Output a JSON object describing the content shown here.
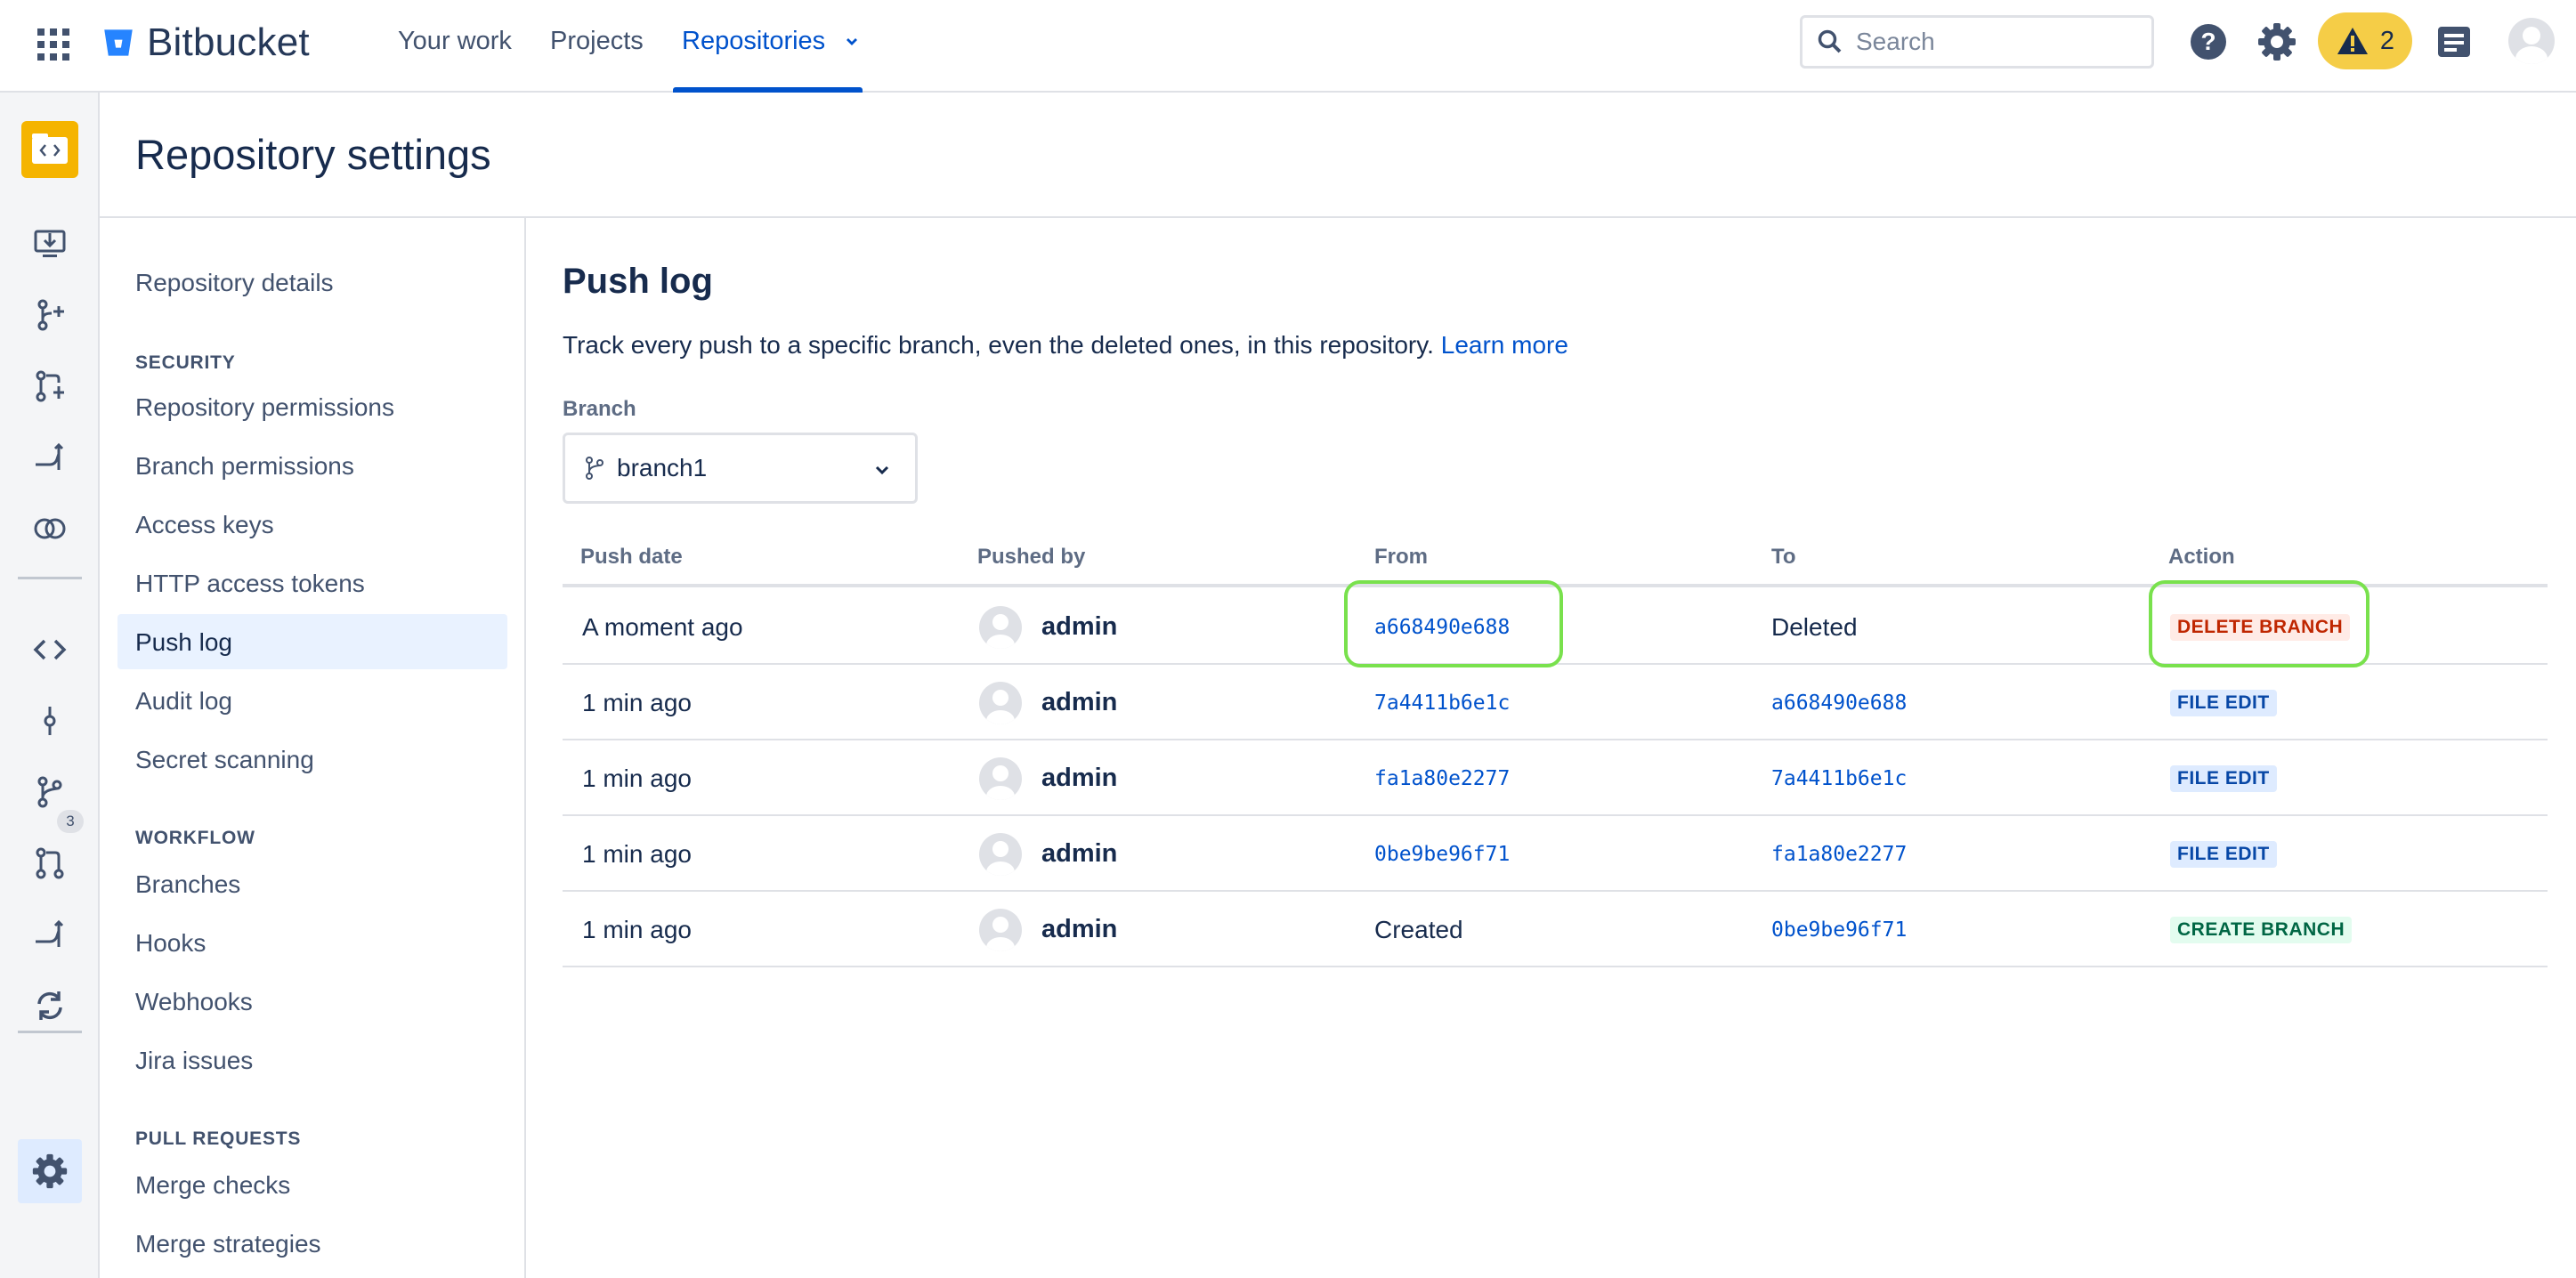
{
  "topbar": {
    "logo_text": "Bitbucket",
    "nav": [
      "Your work",
      "Projects",
      "Repositories"
    ],
    "search_placeholder": "Search",
    "warning_count": "2"
  },
  "rail": {
    "pr_badge": "3"
  },
  "page": {
    "title": "Repository settings"
  },
  "sidebar": {
    "top_link": "Repository details",
    "sections": [
      {
        "title": "SECURITY",
        "items": [
          "Repository permissions",
          "Branch permissions",
          "Access keys",
          "HTTP access tokens",
          "Push log",
          "Audit log",
          "Secret scanning"
        ]
      },
      {
        "title": "WORKFLOW",
        "items": [
          "Branches",
          "Hooks",
          "Webhooks",
          "Jira issues"
        ]
      },
      {
        "title": "PULL REQUESTS",
        "items": [
          "Merge checks",
          "Merge strategies"
        ]
      }
    ],
    "active_item": "Push log"
  },
  "content": {
    "title": "Push log",
    "description": "Track every push to a specific branch, even the deleted ones, in this repository.",
    "learn_more": "Learn more",
    "branch_label": "Branch",
    "branch_value": "branch1"
  },
  "table": {
    "headers": [
      "Push date",
      "Pushed by",
      "From",
      "To",
      "Action"
    ],
    "rows": [
      {
        "date": "A moment ago",
        "user": "admin",
        "from": "a668490e688",
        "to": "Deleted",
        "action": "DELETE BRANCH"
      },
      {
        "date": "1 min ago",
        "user": "admin",
        "from": "7a4411b6e1c",
        "to": "a668490e688",
        "action": "FILE EDIT"
      },
      {
        "date": "1 min ago",
        "user": "admin",
        "from": "fa1a80e2277",
        "to": "7a4411b6e1c",
        "action": "FILE EDIT"
      },
      {
        "date": "1 min ago",
        "user": "admin",
        "from": "0be9be96f71",
        "to": "fa1a80e2277",
        "action": "FILE EDIT"
      },
      {
        "date": "1 min ago",
        "user": "admin",
        "from": "Created",
        "to": "0be9be96f71",
        "action": "CREATE BRANCH"
      }
    ]
  },
  "colors": {
    "brand": "#0052cc",
    "highlight": "#79e14d",
    "delete": "#bf2600",
    "edit": "#0747a6",
    "create": "#006644"
  }
}
